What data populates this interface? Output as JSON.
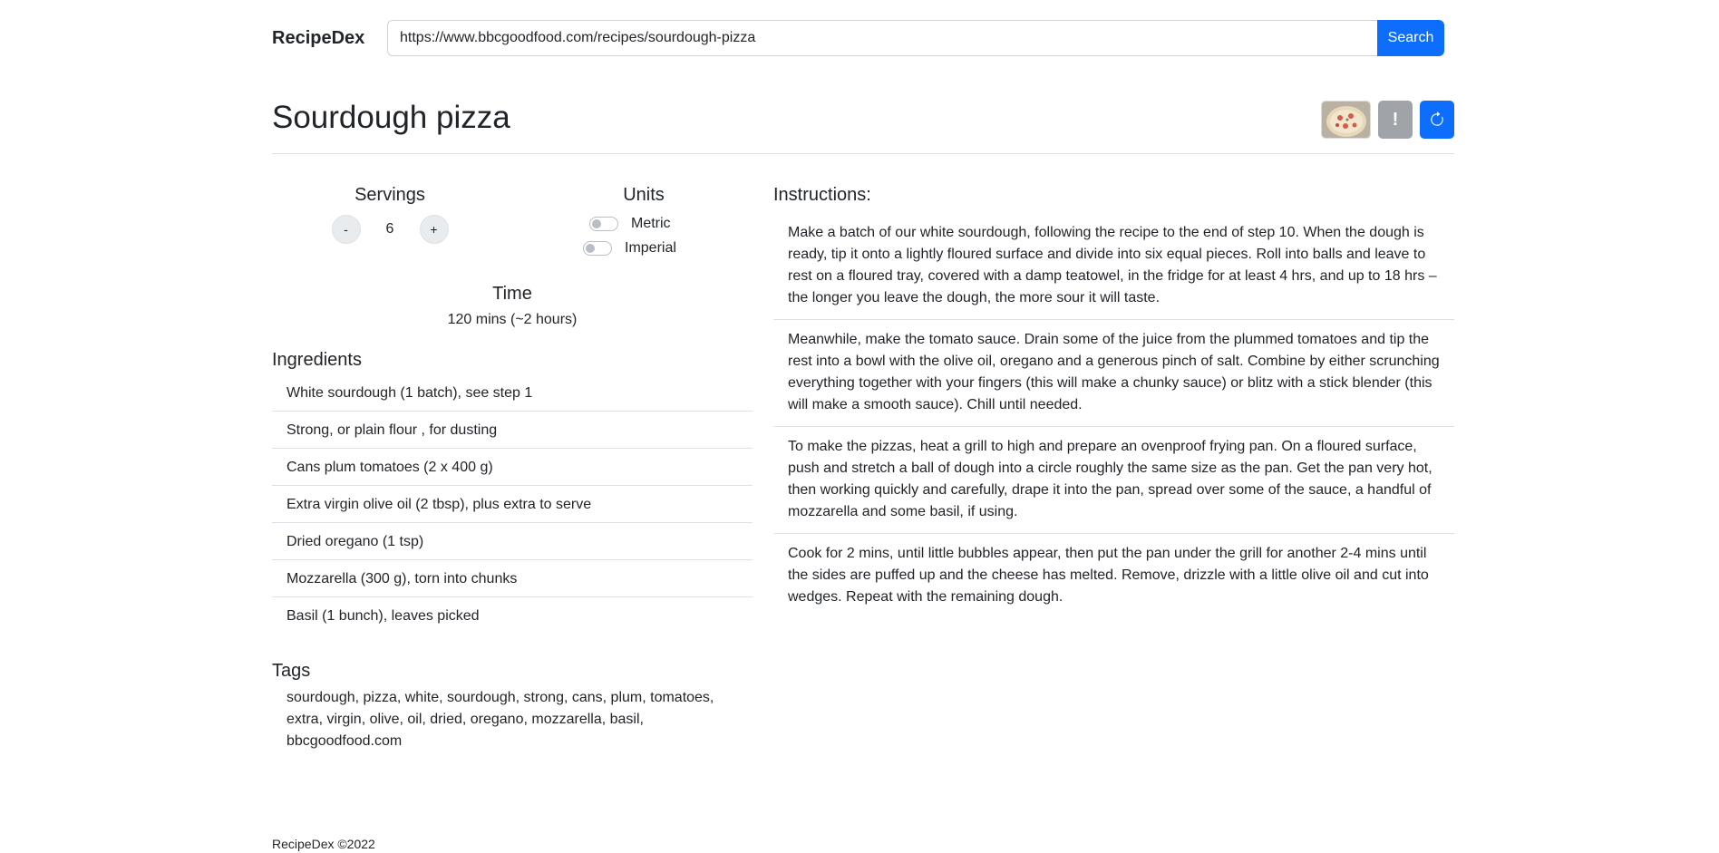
{
  "nav": {
    "brand": "RecipeDex",
    "search_value": "https://www.bbcgoodfood.com/recipes/sourdough-pizza",
    "search_button": "Search"
  },
  "recipe": {
    "title": "Sourdough pizza",
    "alert_button": "!",
    "servings_heading": "Servings",
    "servings_minus": "-",
    "servings_value": "6",
    "servings_plus": "+",
    "units_heading": "Units",
    "unit_metric": "Metric",
    "unit_imperial": "Imperial",
    "time_heading": "Time",
    "time_value": "120 mins (~2 hours)",
    "ingredients_heading": "Ingredients",
    "ingredients": [
      "White sourdough (1 batch), see step 1",
      "Strong, or plain flour , for dusting",
      "Cans plum tomatoes (2 x 400 g)",
      "Extra virgin olive oil (2 tbsp), plus extra to serve",
      "Dried oregano (1 tsp)",
      "Mozzarella (300 g), torn into chunks",
      "Basil (1 bunch), leaves picked"
    ],
    "tags_heading": "Tags",
    "tags_text": "sourdough, pizza, white, sourdough, strong, cans, plum, tomatoes, extra, virgin, olive, oil, dried, oregano, mozzarella, basil, bbcgoodfood.com",
    "instructions_heading": "Instructions:",
    "instructions": [
      "Make a batch of our white sourdough, following the recipe to the end of step 10. When the dough is ready, tip it onto a lightly floured surface and divide into six equal pieces. Roll into balls and leave to rest on a floured tray, covered with a damp teatowel, in the fridge for at least 4 hrs, and up to 18 hrs – the longer you leave the dough, the more sour it will taste.",
      "Meanwhile, make the tomato sauce. Drain some of the juice from the plummed tomatoes and tip the rest into a bowl with the olive oil, oregano and a generous pinch of salt. Combine by either scrunching everything together with your fingers (this will make a chunky sauce) or blitz with a stick blender (this will make a smooth sauce). Chill until needed.",
      "To make the pizzas, heat a grill to high and prepare an ovenproof frying pan. On a floured surface, push and stretch a ball of dough into a circle roughly the same size as the pan. Get the pan very hot, then working quickly and carefully, drape it into the pan, spread over some of the sauce, a handful of mozzarella and some basil, if using.",
      "Cook for 2 mins, until little bubbles appear, then put the pan under the grill for another 2-4 mins until the sides are puffed up and the cheese has melted. Remove, drizzle with a little olive oil and cut into wedges. Repeat with the remaining dough."
    ]
  },
  "footer": "RecipeDex ©2022",
  "colors": {
    "primary": "#0d6efd",
    "secondary": "#a0a4a8",
    "border": "#dee2e6"
  },
  "icons": {
    "refresh": "refresh-icon",
    "alert": "exclamation-icon"
  }
}
